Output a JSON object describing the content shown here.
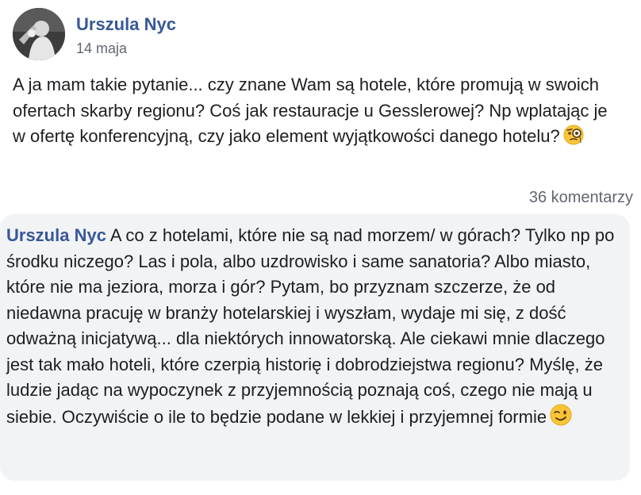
{
  "post": {
    "author": "Urszula Nyc",
    "date": "14 maja",
    "text": "A ja mam takie pytanie... czy znane Wam są hotele, które promują w swoich ofertach skarby regionu? Coś jak restauracje u Gesslerowej? Np wplatając je w ofertę konferencyjną, czy jako element wyjątkowości danego hotelu?",
    "emoji": "monocle-face-emoji"
  },
  "comments_summary": {
    "count_label": "36 komentarzy"
  },
  "comment": {
    "author": "Urszula Nyc",
    "text": "A co z hotelami, które nie są nad morzem/ w górach? Tylko np po środku niczego? Las i pola, albo uzdrowisko i same sanatoria? Albo miasto, które nie ma jeziora, morza i gór? Pytam, bo przyznam szczerze, że od niedawna pracuję w branży hotelarskiej i wyszłam, wydaje mi się, z dość odważną inicjatywą... dla niektórych innowatorską. Ale ciekawi mnie dlaczego jest tak mało hoteli, które czerpią historię i dobrodziejstwa regionu? Myślę, że ludzie jadąc na wypoczynek z przyjemnością poznają coś, czego nie mają u siebie. Oczywiście o ile to będzie podane w lekkiej i przyjemnej formie",
    "emoji": "winking-face-emoji"
  },
  "colors": {
    "link": "#385898",
    "muted": "#606770",
    "text": "#1c1e21",
    "bubble": "#f2f3f5"
  }
}
